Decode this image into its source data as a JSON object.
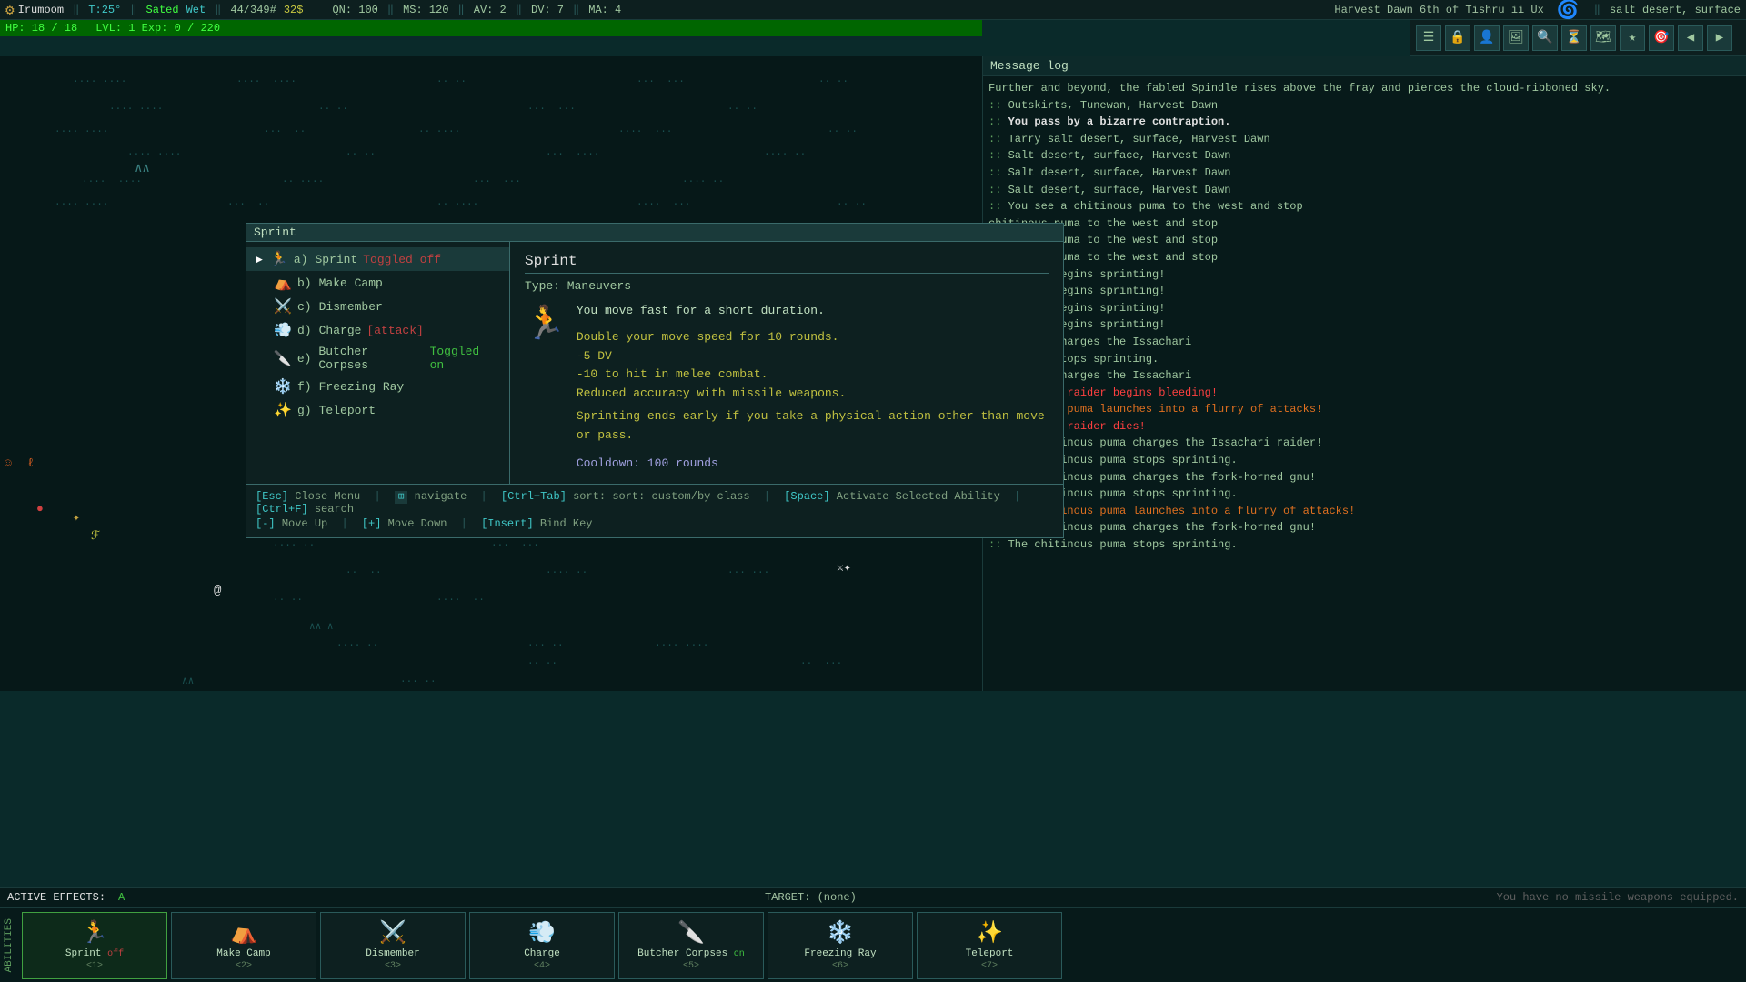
{
  "topbar": {
    "character": "Irumoom",
    "temp": "T:25°",
    "status1": "Sated",
    "status2": "Wet",
    "weight": "44/349#",
    "gold": "32$",
    "qn": "QN: 100",
    "ms": "MS: 120",
    "av": "AV: 2",
    "dv": "DV: 7",
    "ma": "MA: 4",
    "date": "Harvest Dawn 6th of Tishru ii Ux",
    "location": "salt desert, surface"
  },
  "hp": {
    "current": "18",
    "max": "18",
    "label": "HP: 18 / 18",
    "lvl_label": "LVL: 1 Exp: 0 / 220"
  },
  "ability_menu": {
    "title": "Sprint",
    "abilities": [
      {
        "key": "a",
        "name": "Sprint",
        "tag": "Toggled off",
        "selected": true
      },
      {
        "key": "b",
        "name": "Make Camp",
        "tag": "",
        "selected": false
      },
      {
        "key": "c",
        "name": "Dismember",
        "tag": "",
        "selected": false
      },
      {
        "key": "d",
        "name": "Charge",
        "tag": "[attack]",
        "selected": false
      },
      {
        "key": "e",
        "name": "Butcher Corpses",
        "tag": "Toggled on",
        "selected": false
      },
      {
        "key": "f",
        "name": "Freezing Ray",
        "tag": "",
        "selected": false
      },
      {
        "key": "g",
        "name": "Teleport",
        "tag": "",
        "selected": false
      }
    ],
    "detail": {
      "title": "Sprint",
      "type": "Type: Maneuvers",
      "description": "You move fast for a short duration.",
      "effect1": "Double your move speed for 10 rounds.",
      "effect2": "-5 DV",
      "effect3": "-10 to hit in melee combat.",
      "effect4": "Reduced accuracy with missile weapons.",
      "effect5": "Sprinting ends early if you take a physical action other than move or pass.",
      "cooldown": "Cooldown: 100 rounds"
    },
    "footer1_esc": "[Esc]",
    "footer1_close": "Close Menu",
    "footer1_nav_key": "navigate",
    "footer1_sort_key": "[Ctrl+Tab]",
    "footer1_sort": "sort: custom/by class",
    "footer1_space": "[Space]",
    "footer1_activate": "Activate Selected Ability",
    "footer1_search_key": "[Ctrl+F]",
    "footer1_search": "search",
    "footer2_up_key": "[-]",
    "footer2_up": "Move Up",
    "footer2_down_key": "[+]",
    "footer2_down": "Move Down",
    "footer2_bind_key": "[Insert]",
    "footer2_bind": "Bind Key"
  },
  "message_log": {
    "title": "Message log",
    "messages": [
      {
        "type": "normal",
        "text": "Further and beyond, the fabled Spindle rises above the fray and pierces the cloud-ribboned sky."
      },
      {
        "type": "prefix",
        "prefix": ":: ",
        "text": "Outskirts, Tunewan, Harvest Dawn"
      },
      {
        "type": "bold",
        "prefix": ":: ",
        "text": "You pass by a bizarre contraption."
      },
      {
        "type": "normal",
        "prefix": ":: ",
        "text": "Tarry salt desert, surface, Harvest Dawn"
      },
      {
        "type": "normal",
        "prefix": ":: ",
        "text": "Salt desert, surface, Harvest Dawn"
      },
      {
        "type": "normal",
        "prefix": ":: ",
        "text": "Salt desert, surface, Harvest Dawn"
      },
      {
        "type": "normal",
        "prefix": ":: ",
        "text": "Salt desert, surface, Harvest Dawn"
      },
      {
        "type": "normal",
        "prefix": ":: ",
        "text": "You see a chitinous puma to the west and stop"
      },
      {
        "type": "normal",
        "text": "chitinous puma to the west and stop"
      },
      {
        "type": "normal",
        "text": ""
      },
      {
        "type": "normal",
        "text": "chitinous puma to the west and stop"
      },
      {
        "type": "normal",
        "text": ""
      },
      {
        "type": "normal",
        "text": "chitinous puma to the west and stop"
      },
      {
        "type": "normal",
        "text": ""
      },
      {
        "type": "normal",
        "text": "nous puma begins sprinting!"
      },
      {
        "type": "normal",
        "text": "nous puma begins sprinting!"
      },
      {
        "type": "normal",
        "text": "nous puma begins sprinting!"
      },
      {
        "type": "normal",
        "text": "nous puma begins sprinting!"
      },
      {
        "type": "normal",
        "text": "nous puma charges the Issachari"
      },
      {
        "type": "normal",
        "text": ""
      },
      {
        "type": "normal",
        "text": "nous puma stops sprinting."
      },
      {
        "type": "normal",
        "text": "nous puma charges the Issachari"
      },
      {
        "type": "normal",
        "text": ""
      },
      {
        "type": "bright_red",
        "text": "y Issachari raider begins bleeding!"
      },
      {
        "type": "orange",
        "text": "y chitinous puma launches into a flurry of attacks!"
      },
      {
        "type": "bright_red",
        "text": "y Issachari raider dies!"
      },
      {
        "type": "normal",
        "prefix": ":: ",
        "text": "The chitinous puma charges the Issachari raider!"
      },
      {
        "type": "normal",
        "prefix": ":: ",
        "text": "The chitinous puma stops sprinting."
      },
      {
        "type": "normal",
        "prefix": ":: ",
        "text": "The chitinous puma charges the fork-horned gnu!"
      },
      {
        "type": "normal",
        "prefix": ":: ",
        "text": "The chitinous puma stops sprinting."
      },
      {
        "type": "orange",
        "prefix": ":: ",
        "text": "The chitinous puma launches into a flurry of attacks!"
      },
      {
        "type": "normal",
        "prefix": ":: ",
        "text": "The chitinous puma charges the fork-horned gnu!"
      },
      {
        "type": "normal",
        "prefix": ":: ",
        "text": "The chitinous puma stops sprinting."
      }
    ]
  },
  "active_effects": {
    "label": "ACTIVE EFFECTS:",
    "effect": "A"
  },
  "target": {
    "label": "TARGET: (none)"
  },
  "missile": {
    "text": "You have no missile weapons equipped."
  },
  "quickbar": {
    "label": "ABILITIES",
    "items": [
      {
        "key": "<1>",
        "name": "Sprint",
        "status": "off",
        "icon": "🏃"
      },
      {
        "key": "<2>",
        "name": "Make Camp",
        "status": "",
        "icon": "⛺"
      },
      {
        "key": "<3>",
        "name": "Dismember",
        "status": "",
        "icon": "⚔️"
      },
      {
        "key": "<4>",
        "name": "Charge",
        "status": "",
        "icon": "💨"
      },
      {
        "key": "<5>",
        "name": "Butcher Corpses",
        "status": "on",
        "icon": "🔪"
      },
      {
        "key": "<6>",
        "name": "Freezing Ray",
        "status": "",
        "icon": "❄️"
      },
      {
        "key": "<7>",
        "name": "Teleport",
        "status": "",
        "icon": "✨"
      }
    ]
  }
}
